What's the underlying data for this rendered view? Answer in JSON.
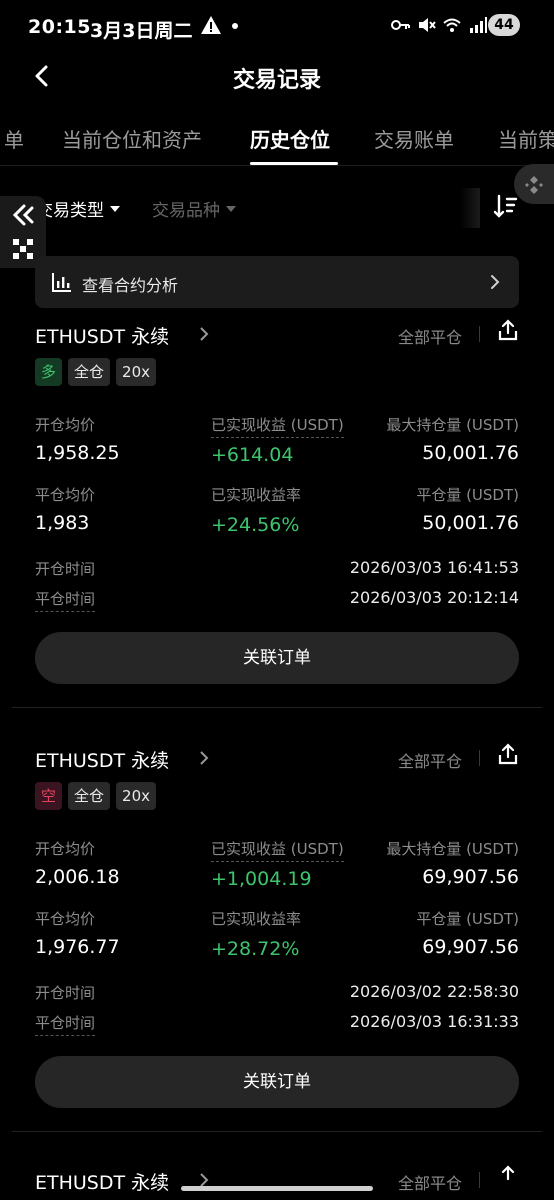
{
  "status_bar": {
    "time": "20:15",
    "date": "3月3日周二",
    "battery": "44"
  },
  "header": {
    "title": "交易记录"
  },
  "tabs": [
    {
      "label": "单"
    },
    {
      "label": "当前仓位和资产"
    },
    {
      "label": "历史仓位"
    },
    {
      "label": "交易账单"
    },
    {
      "label": "当前策"
    }
  ],
  "filters": {
    "type": "交易类型",
    "symbol": "交易品种"
  },
  "analysis": {
    "label": "查看合约分析"
  },
  "labels": {
    "open_avg": "开仓均价",
    "close_avg": "平仓均价",
    "realized_pnl": "已实现收益 (USDT)",
    "realized_rate": "已实现收益率",
    "max_pos": "最大持仓量 (USDT)",
    "close_qty": "平仓量 (USDT)",
    "open_time": "开仓时间",
    "close_time": "平仓时间",
    "close_all": "全部平仓",
    "related_orders": "关联订单"
  },
  "positions": [
    {
      "symbol": "ETHUSDT 永续",
      "side": "多",
      "margin": "全仓",
      "leverage": "20x",
      "open_avg": "1,958.25",
      "close_avg": "1,983",
      "realized_pnl": "+614.04",
      "realized_rate": "+24.56%",
      "max_pos": "50,001.76",
      "close_qty": "50,001.76",
      "open_time": "2026/03/03 16:41:53",
      "close_time": "2026/03/03 20:12:14"
    },
    {
      "symbol": "ETHUSDT 永续",
      "side": "空",
      "margin": "全仓",
      "leverage": "20x",
      "open_avg": "2,006.18",
      "close_avg": "1,976.77",
      "realized_pnl": "+1,004.19",
      "realized_rate": "+28.72%",
      "max_pos": "69,907.56",
      "close_qty": "69,907.56",
      "open_time": "2026/03/02 22:58:30",
      "close_time": "2026/03/03 16:31:33"
    },
    {
      "symbol": "ETHUSDT 永续",
      "close_all": "全部平仓"
    }
  ],
  "colors": {
    "profit_green": "#3ec46d",
    "short_red": "#e0455e",
    "background": "#000000",
    "panel": "#1c1c1c"
  },
  "icons": [
    "back-arrow-icon",
    "warning-icon",
    "key-icon",
    "mute-icon",
    "wifi-icon",
    "signal-icon",
    "caret-down-icon",
    "sort-icon",
    "collapse-icon",
    "scan-icon",
    "binance-icon",
    "bar-chart-icon",
    "chevron-right-icon",
    "share-icon"
  ]
}
